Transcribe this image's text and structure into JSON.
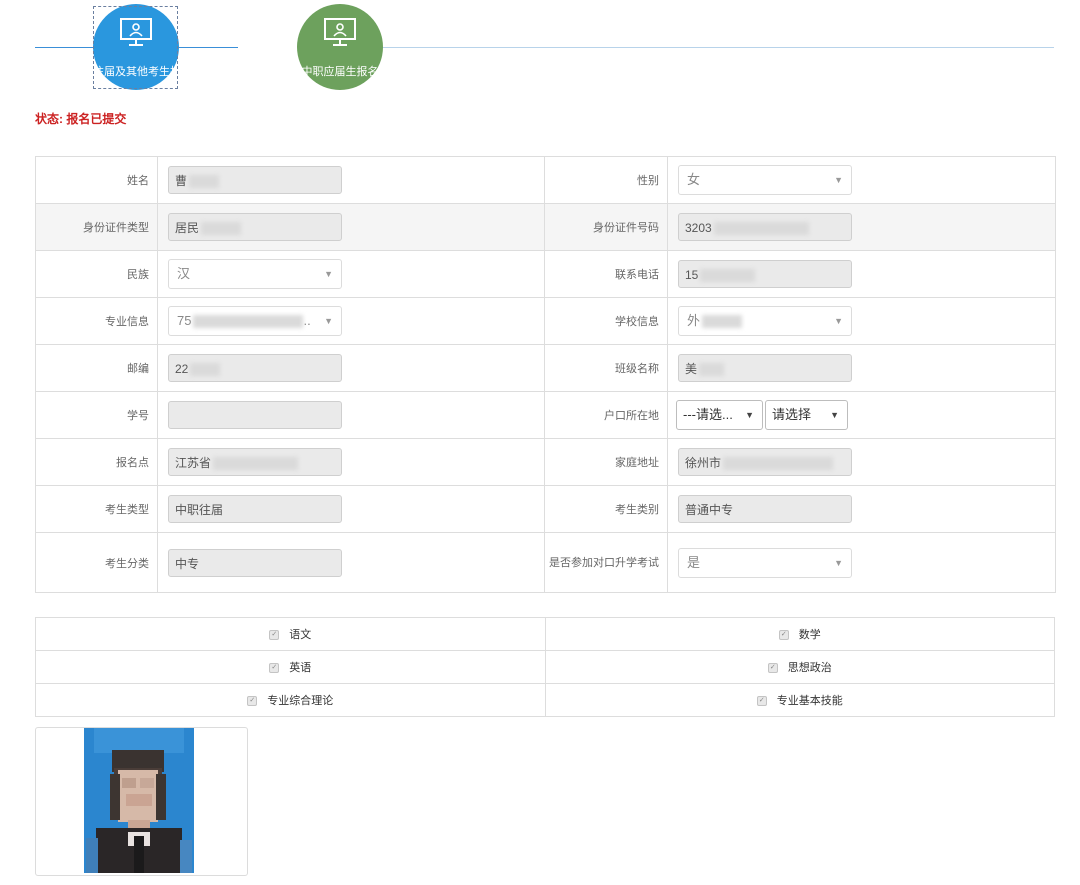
{
  "steps": [
    {
      "label": "往届及其他考生报名",
      "color": "#2a97de",
      "icon": "monitor-user-icon"
    },
    {
      "label": "中职应届生报名",
      "color": "#6da15d",
      "icon": "monitor-user-icon"
    }
  ],
  "status": {
    "text": "状态: 报名已提交"
  },
  "form": {
    "name": {
      "label": "姓名",
      "value": "曹"
    },
    "gender": {
      "label": "性别",
      "value": "女"
    },
    "id_type": {
      "label": "身份证件类型",
      "value": "居民"
    },
    "id_number": {
      "label": "身份证件号码",
      "value": "3203"
    },
    "ethnicity": {
      "label": "民族",
      "value": "汉"
    },
    "phone": {
      "label": "联系电话",
      "value": "15"
    },
    "major": {
      "label": "专业信息",
      "value": "75",
      "suffix": ".."
    },
    "school": {
      "label": "学校信息",
      "value": "外"
    },
    "postcode": {
      "label": "邮编",
      "value": "22"
    },
    "class_name": {
      "label": "班级名称",
      "value": "美"
    },
    "student_no": {
      "label": "学号",
      "value": ""
    },
    "hukou": {
      "label": "户口所在地",
      "value1": "---请选...",
      "value2": "请选择"
    },
    "reg_point": {
      "label": "报名点",
      "value": "江苏省"
    },
    "address": {
      "label": "家庭地址",
      "value": "徐州市"
    },
    "cand_type": {
      "label": "考生类型",
      "value": "中职往届"
    },
    "cand_category": {
      "label": "考生类别",
      "value": "普通中专"
    },
    "cand_class": {
      "label": "考生分类",
      "value": "中专"
    },
    "duikou": {
      "label": "是否参加对口升学考试",
      "value": "是"
    }
  },
  "subjects": [
    {
      "name": "语文",
      "checked": true
    },
    {
      "name": "数学",
      "checked": true
    },
    {
      "name": "英语",
      "checked": true
    },
    {
      "name": "思想政治",
      "checked": true
    },
    {
      "name": "专业综合理论",
      "checked": true
    },
    {
      "name": "专业基本技能",
      "checked": true
    }
  ],
  "colors": {
    "accent_blue": "#2a97de",
    "accent_green": "#6da15d",
    "status_red": "#cc2222"
  }
}
